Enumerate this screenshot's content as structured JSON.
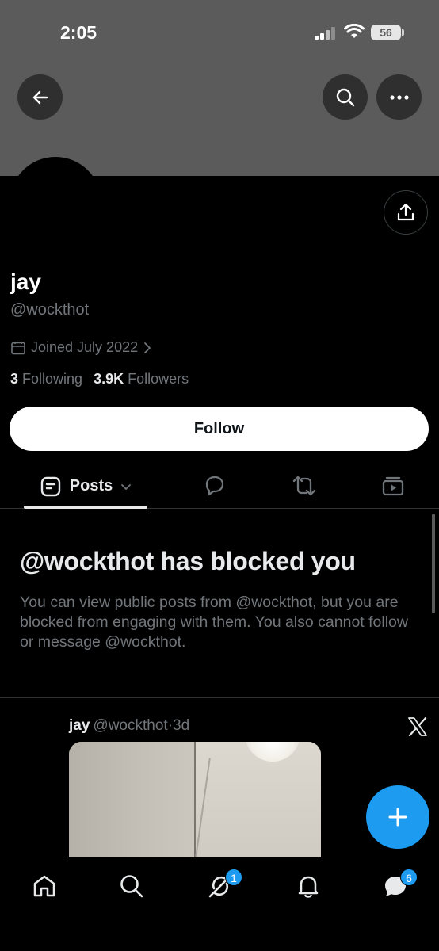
{
  "status_bar": {
    "time": "2:05",
    "battery": "56"
  },
  "profile": {
    "name": "jay",
    "handle": "@wockthot",
    "joined": "Joined July 2022",
    "following_count": "3",
    "following_label": "Following",
    "followers_count": "3.9K",
    "followers_label": "Followers",
    "follow_button": "Follow"
  },
  "tabs": {
    "posts_label": "Posts"
  },
  "blocked": {
    "title": "@wockthot has blocked you",
    "description": "You can view public posts from @wockthot, but you are blocked from engaging with them. You also cannot follow or message @wockthot."
  },
  "post": {
    "author_name": "jay",
    "author_handle": "@wockthot",
    "separator": "·",
    "time": "3d"
  },
  "nav": {
    "grok_badge": "1",
    "messages_badge": "6"
  },
  "colors": {
    "accent": "#1d9bf0",
    "banner": "#5b5b5b",
    "muted_text": "#71767b"
  },
  "icons": [
    "back-arrow-icon",
    "search-icon",
    "more-icon",
    "share-icon",
    "calendar-icon",
    "chevron-right-icon",
    "posts-tab-icon",
    "chevron-down-icon",
    "replies-tab-icon",
    "repost-tab-icon",
    "media-tab-icon",
    "x-logo-icon",
    "plus-icon",
    "home-icon",
    "grok-icon",
    "notifications-icon",
    "messages-icon"
  ]
}
